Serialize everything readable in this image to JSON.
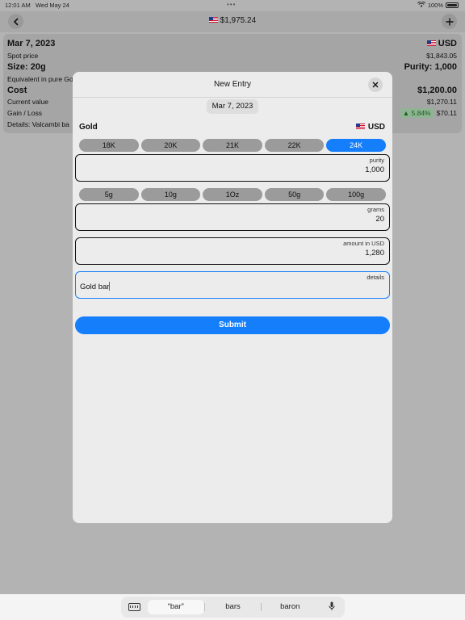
{
  "status": {
    "time": "12:01 AM",
    "date": "Wed May 24",
    "battery": "100%"
  },
  "nav": {
    "title": "$1,975.24",
    "back_icon": "chevron-left-icon",
    "add_icon": "plus-icon"
  },
  "card": {
    "date": "Mar 7, 2023",
    "currency": "USD",
    "spot_label": "Spot price",
    "spot_value": "$1,843.05",
    "size": "Size: 20g",
    "purity": "Purity: 1,000",
    "equiv": "Equivalent in pure Go",
    "cost_label": "Cost",
    "cost_value": "$1,200.00",
    "current_label": "Current value",
    "current_value": "$1,270.11",
    "gain_label": "Gain / Loss",
    "gain_percent": "5.84%",
    "gain_value": "$70.11",
    "details": "Details: Valcambi ba"
  },
  "modal": {
    "title": "New Entry",
    "date": "Mar 7, 2023",
    "metal": "Gold",
    "currency": "USD",
    "purity_options": [
      "18K",
      "20K",
      "21K",
      "22K",
      "24K"
    ],
    "purity_selected": 4,
    "purity_field": {
      "label": "purity",
      "value": "1,000"
    },
    "weight_options": [
      "5g",
      "10g",
      "1Oz",
      "50g",
      "100g"
    ],
    "grams_field": {
      "label": "grams",
      "value": "20"
    },
    "amount_field": {
      "label": "amount in USD",
      "value": "1,280"
    },
    "details_field": {
      "label": "details",
      "value": "Gold bar"
    },
    "submit_label": "Submit"
  },
  "keyboard": {
    "suggestions": [
      "“bar”",
      "bars",
      "baron"
    ]
  }
}
